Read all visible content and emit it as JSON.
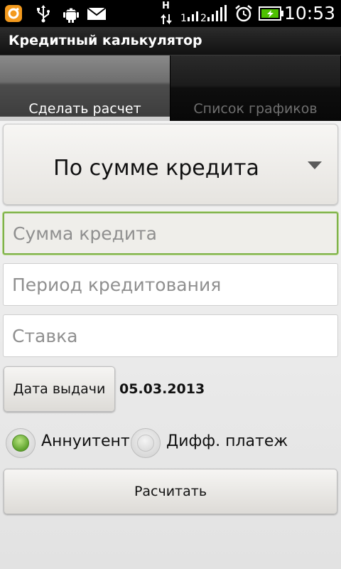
{
  "status_bar": {
    "time": "10:53",
    "network": "H",
    "icons": [
      "notification-icon",
      "usb-icon",
      "android-debug-icon",
      "mail-icon",
      "data-arrows-icon",
      "signal-icon",
      "alarm-icon",
      "battery-charging-icon"
    ],
    "battery_color": "#4ec000"
  },
  "app": {
    "title": "Кредитный калькулятор"
  },
  "tabs": [
    {
      "label": "Сделать расчет",
      "selected": true
    },
    {
      "label": "Список графиков",
      "selected": false
    }
  ],
  "form": {
    "calc_mode": "По сумме кредита",
    "loan_amount_placeholder": "Сумма кредита",
    "loan_period_placeholder": "Период кредитования",
    "rate_placeholder": "Ставка",
    "issue_date_button": "Дата выдачи",
    "issue_date_value": "05.03.2013",
    "payment_types": [
      {
        "label": "Аннуитент",
        "selected": true
      },
      {
        "label": "Дифф. платеж",
        "selected": false
      }
    ],
    "calculate_button": "Расчитать"
  },
  "colors": {
    "accent_green": "#7fb24a",
    "radio_selected": "#5fa32d"
  }
}
